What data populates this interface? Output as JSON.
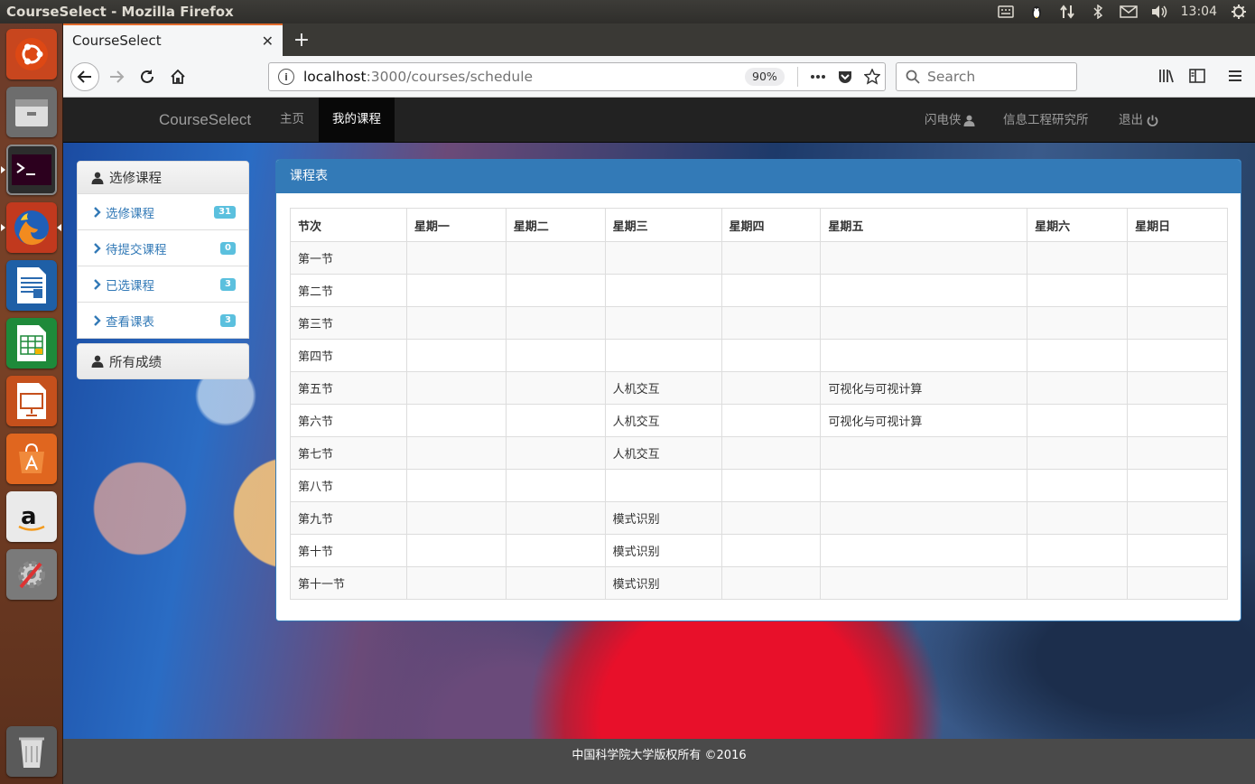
{
  "os": {
    "window_title": "CourseSelect - Mozilla Firefox",
    "clock": "13:04"
  },
  "browser": {
    "tab_title": "CourseSelect",
    "url_host": "localhost",
    "url_rest": ":3000/courses/schedule",
    "zoom": "90%",
    "search_placeholder": "Search"
  },
  "navbar": {
    "brand": "CourseSelect",
    "links": [
      "主页",
      "我的课程"
    ],
    "user": "闪电侠",
    "institute": "信息工程研究所",
    "logout": "退出"
  },
  "sidebar": {
    "section1": "选修课程",
    "items": [
      {
        "label": "选修课程",
        "badge": "31"
      },
      {
        "label": "待提交课程",
        "badge": "0"
      },
      {
        "label": "已选课程",
        "badge": "3"
      },
      {
        "label": "查看课表",
        "badge": "3"
      }
    ],
    "section2": "所有成绩"
  },
  "schedule": {
    "panel_title": "课程表",
    "headers": [
      "节次",
      "星期一",
      "星期二",
      "星期三",
      "星期四",
      "星期五",
      "星期六",
      "星期日"
    ],
    "rows": [
      [
        "第一节",
        "",
        "",
        "",
        "",
        "",
        "",
        ""
      ],
      [
        "第二节",
        "",
        "",
        "",
        "",
        "",
        "",
        ""
      ],
      [
        "第三节",
        "",
        "",
        "",
        "",
        "",
        "",
        ""
      ],
      [
        "第四节",
        "",
        "",
        "",
        "",
        "",
        "",
        ""
      ],
      [
        "第五节",
        "",
        "",
        "人机交互",
        "",
        "可视化与可视计算",
        "",
        ""
      ],
      [
        "第六节",
        "",
        "",
        "人机交互",
        "",
        "可视化与可视计算",
        "",
        ""
      ],
      [
        "第七节",
        "",
        "",
        "人机交互",
        "",
        "",
        "",
        ""
      ],
      [
        "第八节",
        "",
        "",
        "",
        "",
        "",
        "",
        ""
      ],
      [
        "第九节",
        "",
        "",
        "模式识别",
        "",
        "",
        "",
        ""
      ],
      [
        "第十节",
        "",
        "",
        "模式识别",
        "",
        "",
        "",
        ""
      ],
      [
        "第十一节",
        "",
        "",
        "模式识别",
        "",
        "",
        "",
        ""
      ]
    ]
  },
  "footer": {
    "text": "中国科学院大学版权所有 ©2016"
  },
  "colors": {
    "primary": "#337ab7",
    "badge": "#5bc0de",
    "navbar": "#222222"
  }
}
